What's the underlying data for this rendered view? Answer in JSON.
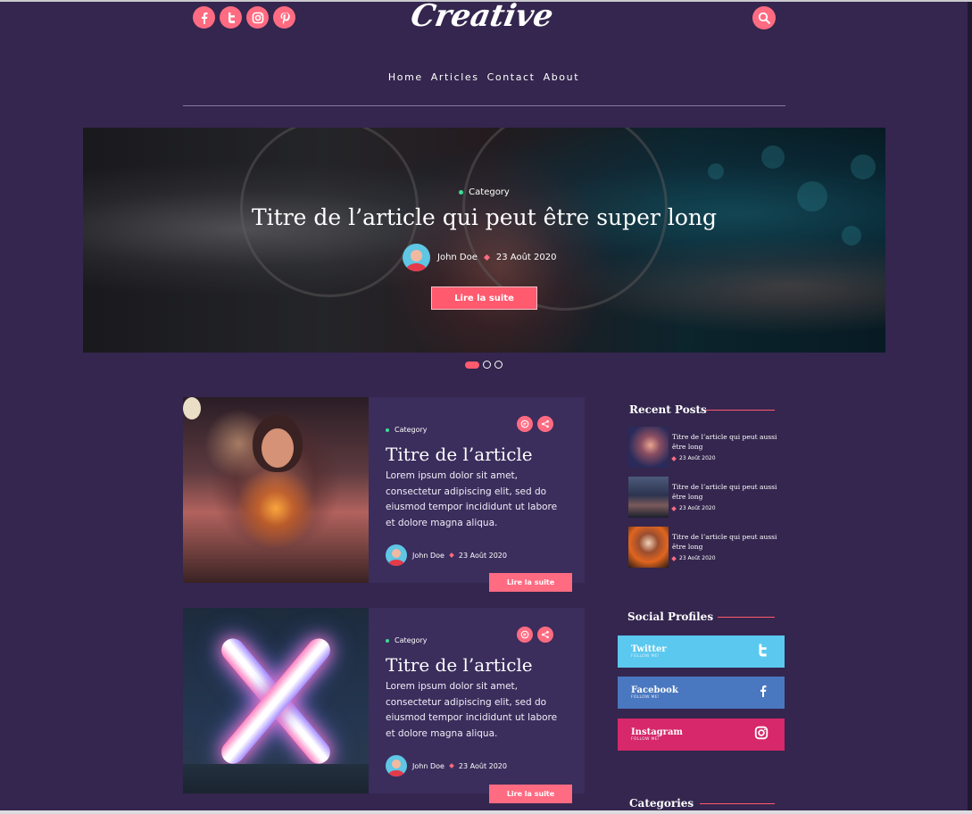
{
  "header": {
    "logo": "Creative",
    "social_icons": [
      "facebook-icon",
      "twitter-icon",
      "instagram-icon",
      "pinterest-icon"
    ],
    "search_icon": "search-icon",
    "nav": [
      "Home",
      "Articles",
      "Contact",
      "About"
    ]
  },
  "hero": {
    "category": "Category",
    "title": "Titre de l’article qui peut être super long",
    "author": "John Doe",
    "date": "23 Août 2020",
    "button": "Lire la suite",
    "slides": 3,
    "active_slide": 1
  },
  "articles": [
    {
      "category": "Category",
      "title": "Titre de l’article",
      "excerpt": "Lorem ipsum dolor sit amet, consectetur adipiscing elit, sed do eiusmod tempor incididunt ut labore et dolore magna aliqua.",
      "author": "John Doe",
      "date": "23 Août 2020",
      "button": "Lire la suite"
    },
    {
      "category": "Category",
      "title": "Titre de l’article",
      "excerpt": "Lorem ipsum dolor sit amet, consectetur adipiscing elit, sed do eiusmod tempor incididunt ut labore et dolore magna aliqua.",
      "author": "John Doe",
      "date": "23 Août 2020",
      "button": "Lire la suite"
    }
  ],
  "sidebar": {
    "recent_title": "Recent Posts",
    "recent_posts": [
      {
        "title": "Titre de l’article qui peut aussi être long",
        "date": "23 Août 2020"
      },
      {
        "title": "Titre de l’article qui peut aussi être long",
        "date": "23 Août 2020"
      },
      {
        "title": "Titre de l’article qui peut aussi être long",
        "date": "23 Août 2020"
      }
    ],
    "social_title": "Social Profiles",
    "social_profiles": [
      {
        "name": "Twitter",
        "sub": "FOLLOW ME!",
        "color": "#5bc8ef",
        "icon": "twitter-icon"
      },
      {
        "name": "Facebook",
        "sub": "FOLLOW ME!",
        "color": "#4a78c0",
        "icon": "facebook-icon"
      },
      {
        "name": "Instagram",
        "sub": "FOLLOW ME!",
        "color": "#d6286a",
        "icon": "instagram-icon"
      }
    ],
    "categories_title": "Categories"
  },
  "colors": {
    "background": "#34264e",
    "accent": "#ff6b81",
    "card": "#3b2d5c"
  }
}
